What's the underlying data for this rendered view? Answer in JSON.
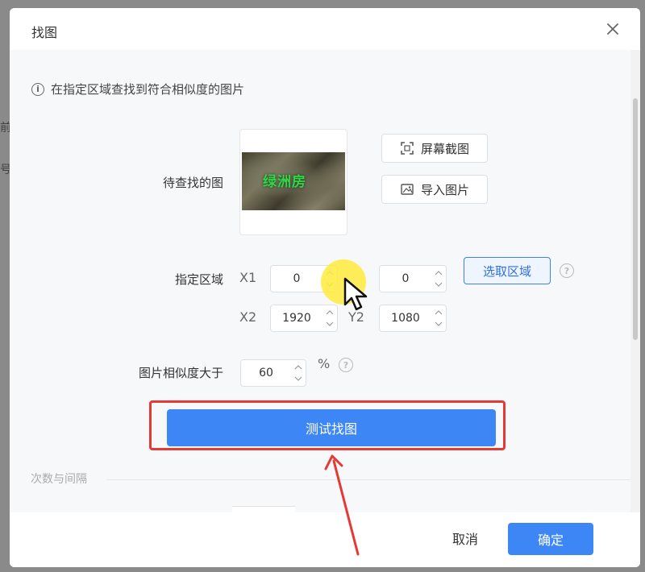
{
  "backdrop": {
    "char1": "前",
    "char2": "号"
  },
  "dialog": {
    "title": "找图",
    "close_icon": "close-icon",
    "info_text": "在指定区域查找到符合相似度的图片",
    "image_section": {
      "label": "待查找的图",
      "preview_text": "绿洲房",
      "screenshot_button": "屏幕截图",
      "import_button": "导入图片"
    },
    "region": {
      "label": "指定区域",
      "x1_label": "X1",
      "x1_value": "0",
      "y1_value": "0",
      "select_button": "选取区域",
      "x2_label": "X2",
      "x2_value": "1920",
      "y2_label": "Y2",
      "y2_value": "1080"
    },
    "similarity": {
      "label": "图片相似度大于",
      "value": "60",
      "unit": "%"
    },
    "test_button": "测试找图",
    "section_label": "次数与间隔",
    "footer": {
      "cancel": "取消",
      "confirm": "确定"
    }
  },
  "colors": {
    "primary": "#3d86f5",
    "highlight_border": "#e53935",
    "cursor_highlight": "#ffeb3b"
  }
}
